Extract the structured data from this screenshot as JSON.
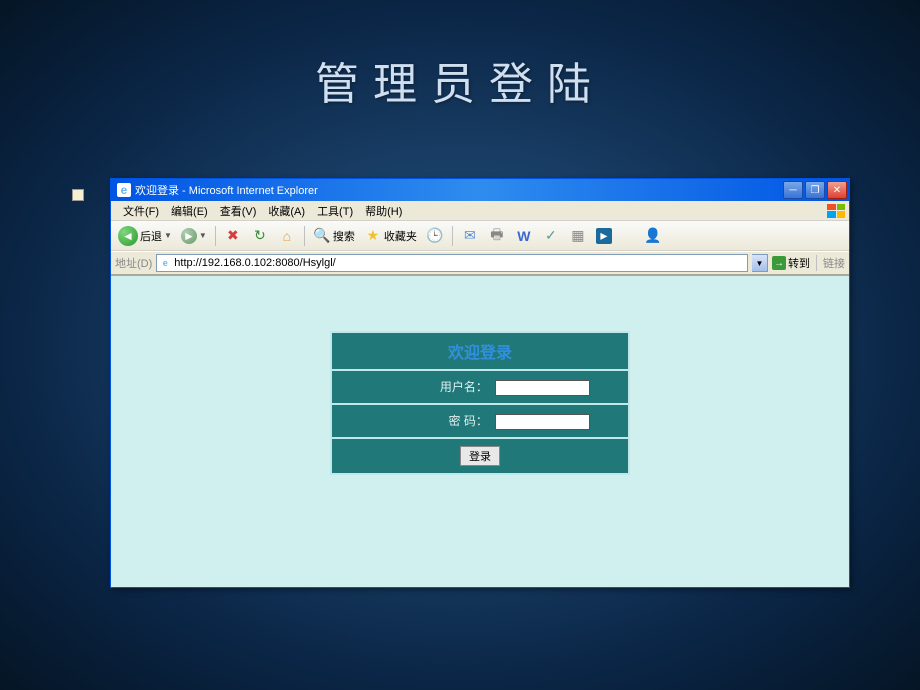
{
  "slide": {
    "title": "管理员登陆"
  },
  "window": {
    "title": "欢迎登录 - Microsoft Internet Explorer"
  },
  "menu": {
    "file": "文件(F)",
    "edit": "编辑(E)",
    "view": "查看(V)",
    "favorites": "收藏(A)",
    "tools": "工具(T)",
    "help": "帮助(H)"
  },
  "toolbar": {
    "back": "后退",
    "search": "搜索",
    "favorites": "收藏夹"
  },
  "addressbar": {
    "label": "地址(D)",
    "url": "http://192.168.0.102:8080/Hsylgl/",
    "go": "转到",
    "links": "链接"
  },
  "login": {
    "title": "欢迎登录",
    "username_label": "用户名：",
    "password_label": "密 码：",
    "button": "登录",
    "username_value": "",
    "password_value": ""
  }
}
